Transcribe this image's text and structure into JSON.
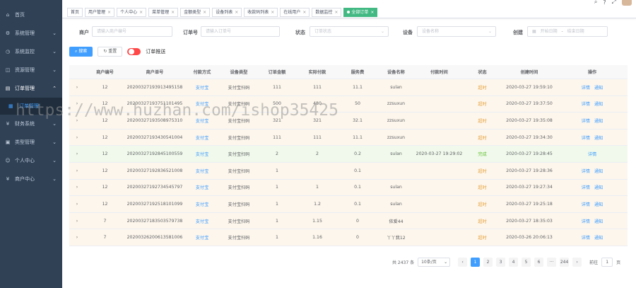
{
  "sidebar": {
    "items": [
      {
        "icon": "home-icon",
        "glyph": "⌂",
        "label": "首页",
        "arrow": ""
      },
      {
        "icon": "gear-icon",
        "glyph": "⚙",
        "label": "系统管理",
        "arrow": "⌄"
      },
      {
        "icon": "monitor-icon",
        "glyph": "◷",
        "label": "系统监控",
        "arrow": "⌄"
      },
      {
        "icon": "resource-icon",
        "glyph": "◫",
        "label": "资源管理",
        "arrow": "⌄"
      },
      {
        "icon": "order-icon",
        "glyph": "▤",
        "label": "订单管理",
        "arrow": "⌃"
      }
    ],
    "sub_item": {
      "icon": "list-icon",
      "glyph": "▦",
      "label": "订单管理"
    },
    "items_after": [
      {
        "icon": "finance-icon",
        "glyph": "¥",
        "label": "财务系统",
        "arrow": "⌄"
      },
      {
        "icon": "type-icon",
        "glyph": "▣",
        "label": "类型管理",
        "arrow": "⌄"
      },
      {
        "icon": "user-icon",
        "glyph": "☺",
        "label": "个人中心",
        "arrow": "⌄"
      },
      {
        "icon": "merchant-icon",
        "glyph": "¥",
        "label": "商户中心",
        "arrow": "⌄"
      }
    ]
  },
  "tabs": [
    {
      "label": "首页",
      "close": false
    },
    {
      "label": "用户管理",
      "close": true
    },
    {
      "label": "个人中心",
      "close": true
    },
    {
      "label": "菜单管理",
      "close": true
    },
    {
      "label": "金额类型",
      "close": true
    },
    {
      "label": "设备列表",
      "close": true
    },
    {
      "label": "收款码列表",
      "close": true
    },
    {
      "label": "在线用户",
      "close": true
    },
    {
      "label": "数据监控",
      "close": true
    },
    {
      "label": "全部订单",
      "close": true,
      "active": true
    }
  ],
  "filters": {
    "merchant_label": "商户",
    "merchant_placeholder": "请输入商户编号",
    "order_label": "订单号",
    "order_placeholder": "请输入订单号",
    "status_label": "状态",
    "status_placeholder": "订单状态",
    "device_label": "设备",
    "device_placeholder": "设备名称",
    "created_label": "创建",
    "start_placeholder": "开始日期",
    "end_placeholder": "结束日期"
  },
  "actions": {
    "search": "搜索",
    "reset": "重置",
    "toggle_label": "订单推送"
  },
  "table": {
    "headers": [
      "",
      "商户编号",
      "商户单号",
      "付款方式",
      "设备类型",
      "订单金额",
      "实际付款",
      "服务费",
      "设备名称",
      "付款时间",
      "状态",
      "创建时间",
      "操作"
    ],
    "rows": [
      {
        "merchant": "12",
        "order": "20200327193913495158",
        "pay": "支付宝",
        "device_type": "支付宝扫码",
        "amount": "111",
        "paid": "111",
        "fee": "11.1",
        "device": "sulan",
        "pay_time": "",
        "status": "超时",
        "created": "2020-03-27 19:59:10",
        "ops": [
          "详情",
          "通知"
        ]
      },
      {
        "merchant": "12",
        "order": "20200327193751101495",
        "pay": "支付宝",
        "device_type": "支付宝扫码",
        "amount": "500",
        "paid": "480",
        "fee": "50",
        "device": "zzsuxun",
        "pay_time": "",
        "status": "超时",
        "created": "2020-03-27 19:37:50",
        "ops": [
          "详情",
          "通知"
        ]
      },
      {
        "merchant": "12",
        "order": "20200327193508975310",
        "pay": "支付宝",
        "device_type": "支付宝扫码",
        "amount": "321",
        "paid": "321",
        "fee": "32.1",
        "device": "zzsuxun",
        "pay_time": "",
        "status": "超时",
        "created": "2020-03-27 19:35:08",
        "ops": [
          "详情",
          "通知"
        ]
      },
      {
        "merchant": "12",
        "order": "20200327193430541004",
        "pay": "支付宝",
        "device_type": "支付宝扫码",
        "amount": "111",
        "paid": "111",
        "fee": "11.1",
        "device": "zzsuxun",
        "pay_time": "",
        "status": "超时",
        "created": "2020-03-27 19:34:30",
        "ops": [
          "详情",
          "通知"
        ]
      },
      {
        "merchant": "12",
        "order": "20200327192845100559",
        "pay": "支付宝",
        "device_type": "支付宝扫码",
        "amount": "2",
        "paid": "2",
        "fee": "0.2",
        "device": "sulan",
        "pay_time": "2020-03-27 19:29:02",
        "status": "完成",
        "created": "2020-03-27 19:28:45",
        "ops": [
          "详情"
        ],
        "success": true
      },
      {
        "merchant": "12",
        "order": "20200327192836521008",
        "pay": "支付宝",
        "device_type": "支付宝扫码",
        "amount": "1",
        "paid": "",
        "fee": "0.1",
        "device": "",
        "pay_time": "",
        "status": "超时",
        "created": "2020-03-27 19:28:36",
        "ops": [
          "详情",
          "通知"
        ]
      },
      {
        "merchant": "12",
        "order": "20200327192734545797",
        "pay": "支付宝",
        "device_type": "支付宝扫码",
        "amount": "1",
        "paid": "1",
        "fee": "0.1",
        "device": "sulan",
        "pay_time": "",
        "status": "超时",
        "created": "2020-03-27 19:27:34",
        "ops": [
          "详情",
          "通知"
        ]
      },
      {
        "merchant": "12",
        "order": "20200327192518101099",
        "pay": "支付宝",
        "device_type": "支付宝扫码",
        "amount": "1",
        "paid": "1.2",
        "fee": "0.1",
        "device": "sulan",
        "pay_time": "",
        "status": "超时",
        "created": "2020-03-27 19:25:18",
        "ops": [
          "详情",
          "通知"
        ]
      },
      {
        "merchant": "7",
        "order": "20200327183503579738",
        "pay": "支付宝",
        "device_type": "支付宝扫码",
        "amount": "1",
        "paid": "1.15",
        "fee": "0",
        "device": "依爱44",
        "pay_time": "",
        "status": "超时",
        "created": "2020-03-27 18:35:03",
        "ops": [
          "详情",
          "通知"
        ]
      },
      {
        "merchant": "7",
        "order": "20200326200613581006",
        "pay": "支付宝",
        "device_type": "支付宝扫码",
        "amount": "1",
        "paid": "1.16",
        "fee": "0",
        "device": "丫丫我12",
        "pay_time": "",
        "status": "超时",
        "created": "2020-03-26 20:06:13",
        "ops": [
          "详情",
          "通知"
        ]
      }
    ]
  },
  "pager": {
    "total": "共 2437 条",
    "page_size": "10条/页",
    "prev": "‹",
    "pages": [
      "1",
      "2",
      "3",
      "4",
      "5",
      "6",
      "···",
      "244"
    ],
    "next": "›",
    "goto_label": "前往",
    "goto_value": "1",
    "goto_suffix": "页"
  },
  "watermark": "https://www.huzhan.com/ishop35425",
  "colors": {
    "sidebar": "#304156",
    "primary": "#409eff",
    "warning": "#e6a23c",
    "success": "#67c23a",
    "danger": "#ff4949"
  }
}
